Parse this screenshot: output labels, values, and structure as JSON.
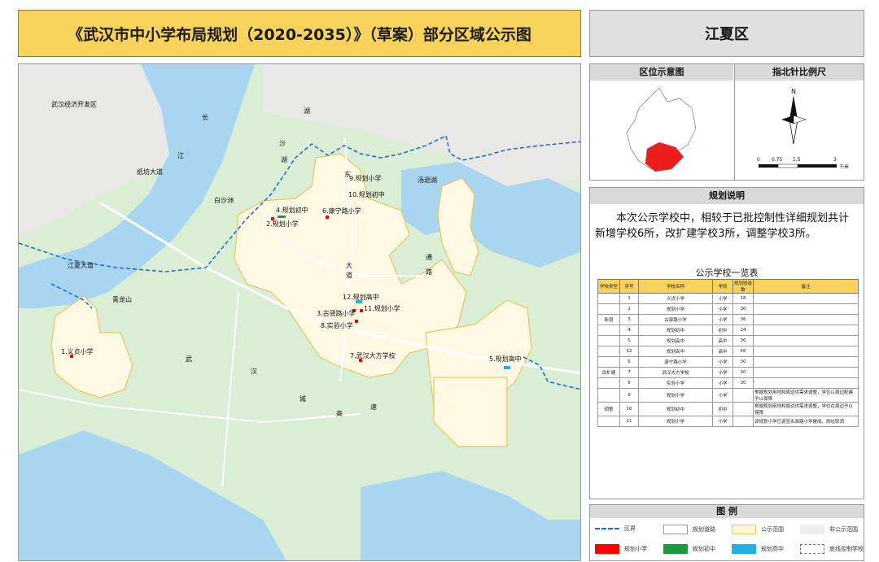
{
  "title": "《武汉市中小学布局规划（2020-2035）》（草案）部分区域公示图",
  "district": "江夏区",
  "location_map": {
    "heading": "区位示意图"
  },
  "compass": {
    "heading": "指北针比例尺",
    "north": "N",
    "scale_ticks": [
      "0",
      "0.75",
      "1.5",
      "3"
    ],
    "unit": "千米"
  },
  "plan_note": {
    "heading": "规划说明",
    "text": "本次公示学校中，相较于已批控制性详细规划共计新增学校6所，改扩建学校3所，调整学校3所。"
  },
  "school_table": {
    "title": "公示学校一览表",
    "headers": [
      "学校类型",
      "序号",
      "学校名称",
      "学段",
      "规划班级数",
      "备注"
    ],
    "rows": [
      {
        "group": "",
        "no": "1",
        "name": "义贞小学",
        "level": "小学",
        "classes": "18",
        "note": ""
      },
      {
        "group": "",
        "no": "2",
        "name": "规划小学",
        "level": "小学",
        "classes": "30",
        "note": ""
      },
      {
        "group": "新增",
        "no": "3",
        "name": "古驿路小学",
        "level": "小学",
        "classes": "36",
        "note": ""
      },
      {
        "group": "",
        "no": "4",
        "name": "规划初中",
        "level": "初中",
        "classes": "24",
        "note": ""
      },
      {
        "group": "",
        "no": "5",
        "name": "规划高中",
        "level": "高中",
        "classes": "36",
        "note": ""
      },
      {
        "group": "",
        "no": "12",
        "name": "规划高中",
        "level": "高中",
        "classes": "48",
        "note": ""
      },
      {
        "group": "",
        "no": "6",
        "name": "康宁路小学",
        "level": "小学",
        "classes": "30",
        "note": ""
      },
      {
        "group": "改扩建",
        "no": "7",
        "name": "武汉大方学校",
        "level": "小学",
        "classes": "30",
        "note": ""
      },
      {
        "group": "",
        "no": "8",
        "name": "实验小学",
        "level": "小学",
        "classes": "30",
        "note": ""
      },
      {
        "group": "",
        "no": "9",
        "name": "规划小学",
        "level": "小学",
        "classes": "",
        "note": "根据规划用地和周边供需求调整，学位以周边配建予以保障"
      },
      {
        "group": "调整",
        "no": "10",
        "name": "规划初中",
        "level": "初中",
        "classes": "",
        "note": "根据规划用地和周边供需求调整，学位在周边予以保障"
      },
      {
        "group": "",
        "no": "11",
        "name": "规划小学",
        "level": "小学",
        "classes": "",
        "note": "该规划小学已调至古驿路小学建成，原址取消"
      }
    ]
  },
  "legend": {
    "heading": "图  例",
    "items": [
      {
        "label": "区界",
        "color": "#1f6fc4"
      },
      {
        "label": "规划道路",
        "color": "#ffffff"
      },
      {
        "label": "公示范围",
        "color": "#fff6d8"
      },
      {
        "label": "非公示范围",
        "color": "#eeeeee"
      },
      {
        "label": "规划小学",
        "color": "#ff0000"
      },
      {
        "label": "规划初中",
        "color": "#1a9a3a"
      },
      {
        "label": "规划高中",
        "color": "#22b0e6"
      },
      {
        "label": "底线控制学校",
        "color": "#ffffff"
      }
    ]
  },
  "map": {
    "place_labels": [
      "武汉经济开发区",
      "长",
      "江",
      "沙",
      "湖",
      "纸坊大道",
      "青龙山",
      "汤逊湖",
      "白沙洲",
      "江夏大道",
      "东",
      "大",
      "道",
      "湖",
      "通",
      "路",
      "武",
      "汉",
      "城",
      "高",
      "速"
    ],
    "schools": [
      {
        "label": "1.义贞小学",
        "type": "primary"
      },
      {
        "label": "2.规划小学",
        "type": "primary"
      },
      {
        "label": "3.古驿路小学",
        "type": "primary"
      },
      {
        "label": "4.规划初中",
        "type": "middle"
      },
      {
        "label": "5.规划高中",
        "type": "high"
      },
      {
        "label": "6.康宁路小学",
        "type": "primary"
      },
      {
        "label": "7.武汉大方学校",
        "type": "primary"
      },
      {
        "label": "8.实验小学",
        "type": "primary"
      },
      {
        "label": "9.规划小学",
        "type": "primary"
      },
      {
        "label": "10.规划初中",
        "type": "middle"
      },
      {
        "label": "11.规划小学",
        "type": "primary"
      },
      {
        "label": "12.规划高中",
        "type": "high"
      }
    ]
  }
}
